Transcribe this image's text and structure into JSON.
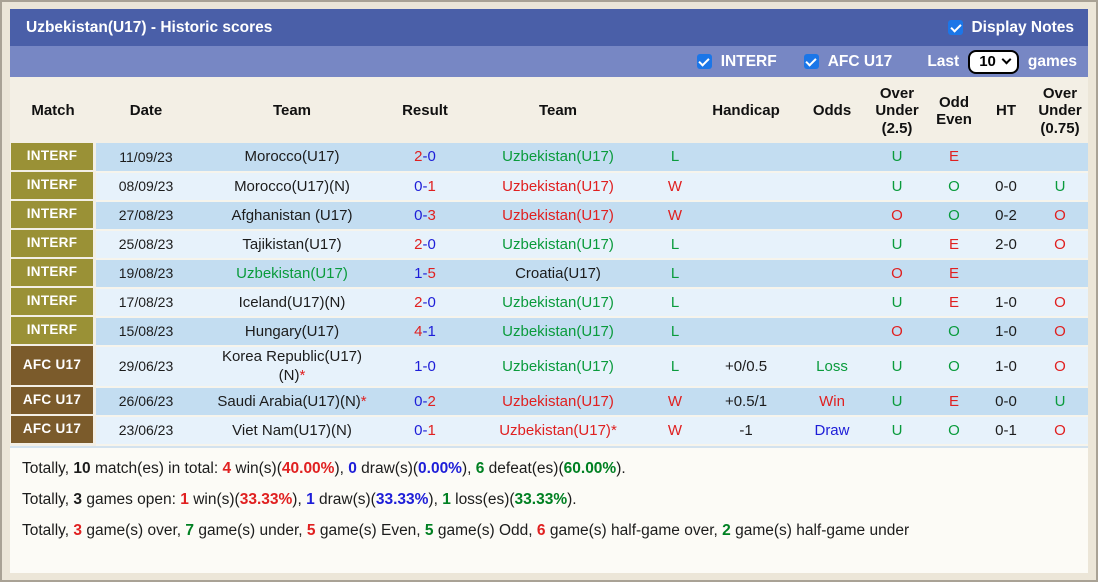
{
  "title": "Uzbekistan(U17) - Historic scores",
  "display_notes": {
    "label": "Display Notes",
    "checked": true
  },
  "filters": {
    "interf_label": "INTERF",
    "interf_checked": true,
    "afc_label": "AFC U17",
    "afc_checked": true,
    "last_label": "Last",
    "last_value": "10",
    "games_label": "games"
  },
  "colors": {
    "red": "#e02020",
    "blue": "#1d1dd8",
    "green": "#0a9b3c",
    "dark_green": "#008022",
    "black": "#1c1c1c",
    "title_bar": "#4a5fa8",
    "filter_bar": "#7787c4",
    "badge_interf": "#9a9136",
    "badge_afc": "#7b5b2b",
    "row_dark": "#c3ddf1",
    "row_light": "#e7f2fb",
    "checkbox_blue": "#1b76e8"
  },
  "table": {
    "columns": [
      {
        "key": "match",
        "label": "Match"
      },
      {
        "key": "date",
        "label": "Date"
      },
      {
        "key": "team1",
        "label": "Team"
      },
      {
        "key": "result",
        "label": "Result"
      },
      {
        "key": "team2",
        "label": "Team"
      },
      {
        "key": "wl",
        "label": ""
      },
      {
        "key": "handicap",
        "label": "Handicap"
      },
      {
        "key": "odds",
        "label": "Odds"
      },
      {
        "key": "ou25",
        "label": "Over Under (2.5)"
      },
      {
        "key": "oddeven",
        "label": "Odd Even"
      },
      {
        "key": "ht",
        "label": "HT"
      },
      {
        "key": "ou075",
        "label": "Over Under (0.75)"
      }
    ],
    "rows": [
      {
        "league": "INTERF",
        "league_key": "interf",
        "date": "11/09/23",
        "home": {
          "text": "Morocco(U17)",
          "color": "black"
        },
        "score": [
          [
            "2",
            "red"
          ],
          [
            "-0",
            "blue"
          ]
        ],
        "away": {
          "text": "Uzbekistan(U17)",
          "color": "green"
        },
        "wl": [
          "L",
          "green"
        ],
        "handicap": "",
        "odds": [
          "",
          ""
        ],
        "ou25": [
          "U",
          "green"
        ],
        "oe": [
          "E",
          "red"
        ],
        "ht": "",
        "ou075": [
          "",
          ""
        ],
        "shade": "dark"
      },
      {
        "league": "INTERF",
        "league_key": "interf",
        "date": "08/09/23",
        "home": {
          "text": "Morocco(U17)(N)",
          "color": "black"
        },
        "score": [
          [
            "0-",
            "blue"
          ],
          [
            "1",
            "red"
          ]
        ],
        "away": {
          "text": "Uzbekistan(U17)",
          "color": "red"
        },
        "wl": [
          "W",
          "red"
        ],
        "handicap": "",
        "odds": [
          "",
          ""
        ],
        "ou25": [
          "U",
          "green"
        ],
        "oe": [
          "O",
          "green"
        ],
        "ht": "0-0",
        "ou075": [
          "U",
          "green"
        ],
        "shade": "light"
      },
      {
        "league": "INTERF",
        "league_key": "interf",
        "date": "27/08/23",
        "home": {
          "text": "Afghanistan (U17)",
          "color": "black"
        },
        "score": [
          [
            "0-",
            "blue"
          ],
          [
            "3",
            "red"
          ]
        ],
        "away": {
          "text": "Uzbekistan(U17)",
          "color": "red"
        },
        "wl": [
          "W",
          "red"
        ],
        "handicap": "",
        "odds": [
          "",
          ""
        ],
        "ou25": [
          "O",
          "red"
        ],
        "oe": [
          "O",
          "green"
        ],
        "ht": "0-2",
        "ou075": [
          "O",
          "red"
        ],
        "shade": "dark"
      },
      {
        "league": "INTERF",
        "league_key": "interf",
        "date": "25/08/23",
        "home": {
          "text": "Tajikistan(U17)",
          "color": "black"
        },
        "score": [
          [
            "2",
            "red"
          ],
          [
            "-0",
            "blue"
          ]
        ],
        "away": {
          "text": "Uzbekistan(U17)",
          "color": "green"
        },
        "wl": [
          "L",
          "green"
        ],
        "handicap": "",
        "odds": [
          "",
          ""
        ],
        "ou25": [
          "U",
          "green"
        ],
        "oe": [
          "E",
          "red"
        ],
        "ht": "2-0",
        "ou075": [
          "O",
          "red"
        ],
        "shade": "light"
      },
      {
        "league": "INTERF",
        "league_key": "interf",
        "date": "19/08/23",
        "home": {
          "text": "Uzbekistan(U17)",
          "color": "green"
        },
        "score": [
          [
            "1-",
            "blue"
          ],
          [
            "5",
            "red"
          ]
        ],
        "away": {
          "text": "Croatia(U17)",
          "color": "black"
        },
        "wl": [
          "L",
          "green"
        ],
        "handicap": "",
        "odds": [
          "",
          ""
        ],
        "ou25": [
          "O",
          "red"
        ],
        "oe": [
          "E",
          "red"
        ],
        "ht": "",
        "ou075": [
          "",
          ""
        ],
        "shade": "dark"
      },
      {
        "league": "INTERF",
        "league_key": "interf",
        "date": "17/08/23",
        "home": {
          "text": "Iceland(U17)(N)",
          "color": "black"
        },
        "score": [
          [
            "2",
            "red"
          ],
          [
            "-0",
            "blue"
          ]
        ],
        "away": {
          "text": "Uzbekistan(U17)",
          "color": "green"
        },
        "wl": [
          "L",
          "green"
        ],
        "handicap": "",
        "odds": [
          "",
          ""
        ],
        "ou25": [
          "U",
          "green"
        ],
        "oe": [
          "E",
          "red"
        ],
        "ht": "1-0",
        "ou075": [
          "O",
          "red"
        ],
        "shade": "light"
      },
      {
        "league": "INTERF",
        "league_key": "interf",
        "date": "15/08/23",
        "home": {
          "text": "Hungary(U17)",
          "color": "black"
        },
        "score": [
          [
            "4",
            "red"
          ],
          [
            "-1",
            "blue"
          ]
        ],
        "away": {
          "text": "Uzbekistan(U17)",
          "color": "green"
        },
        "wl": [
          "L",
          "green"
        ],
        "handicap": "",
        "odds": [
          "",
          ""
        ],
        "ou25": [
          "O",
          "red"
        ],
        "oe": [
          "O",
          "green"
        ],
        "ht": "1-0",
        "ou075": [
          "O",
          "red"
        ],
        "shade": "dark"
      },
      {
        "league": "AFC U17",
        "league_key": "afc",
        "date": "29/06/23",
        "home": {
          "line1": "Korea Republic(U17)",
          "line2": "(N)",
          "star": true,
          "color": "black"
        },
        "score": [
          [
            "1-0",
            "blue"
          ]
        ],
        "away": {
          "text": "Uzbekistan(U17)",
          "color": "green"
        },
        "wl": [
          "L",
          "green"
        ],
        "handicap": "+0/0.5",
        "odds": [
          "Loss",
          "green"
        ],
        "ou25": [
          "U",
          "green"
        ],
        "oe": [
          "O",
          "green"
        ],
        "ht": "1-0",
        "ou075": [
          "O",
          "red"
        ],
        "shade": "light"
      },
      {
        "league": "AFC U17",
        "league_key": "afc",
        "date": "26/06/23",
        "home": {
          "text": "Saudi Arabia(U17)(N)",
          "star": true,
          "color": "black"
        },
        "score": [
          [
            "0-",
            "blue"
          ],
          [
            "2",
            "red"
          ]
        ],
        "away": {
          "text": "Uzbekistan(U17)",
          "color": "red"
        },
        "wl": [
          "W",
          "red"
        ],
        "handicap": "+0.5/1",
        "odds": [
          "Win",
          "red"
        ],
        "ou25": [
          "U",
          "green"
        ],
        "oe": [
          "E",
          "red"
        ],
        "ht": "0-0",
        "ou075": [
          "U",
          "green"
        ],
        "shade": "dark"
      },
      {
        "league": "AFC U17",
        "league_key": "afc",
        "date": "23/06/23",
        "home": {
          "text": "Viet Nam(U17)(N)",
          "color": "black"
        },
        "score": [
          [
            "0-",
            "blue"
          ],
          [
            "1",
            "red"
          ]
        ],
        "away": {
          "text": "Uzbekistan(U17)",
          "color": "red",
          "star": true
        },
        "wl": [
          "W",
          "red"
        ],
        "handicap": "-1",
        "odds": [
          "Draw",
          "blue"
        ],
        "ou25": [
          "U",
          "green"
        ],
        "oe": [
          "O",
          "green"
        ],
        "ht": "0-1",
        "ou075": [
          "O",
          "red"
        ],
        "shade": "light"
      }
    ]
  },
  "summary": [
    [
      [
        "Totally, ",
        "black",
        false
      ],
      [
        "10",
        "black",
        true
      ],
      [
        " match(es) in total: ",
        "black",
        false
      ],
      [
        "4",
        "red",
        true
      ],
      [
        " win(s)(",
        "black",
        false
      ],
      [
        "40.00%",
        "red",
        true
      ],
      [
        "), ",
        "black",
        false
      ],
      [
        "0",
        "blue",
        true
      ],
      [
        " draw(s)(",
        "black",
        false
      ],
      [
        "0.00%",
        "blue",
        true
      ],
      [
        "), ",
        "black",
        false
      ],
      [
        "6",
        "dark_green",
        true
      ],
      [
        " defeat(es)(",
        "black",
        false
      ],
      [
        "60.00%",
        "dark_green",
        true
      ],
      [
        ").",
        "black",
        false
      ]
    ],
    [
      [
        "Totally, ",
        "black",
        false
      ],
      [
        "3",
        "black",
        true
      ],
      [
        " games open: ",
        "black",
        false
      ],
      [
        "1",
        "red",
        true
      ],
      [
        " win(s)(",
        "black",
        false
      ],
      [
        "33.33%",
        "red",
        true
      ],
      [
        "), ",
        "black",
        false
      ],
      [
        "1",
        "blue",
        true
      ],
      [
        " draw(s)(",
        "black",
        false
      ],
      [
        "33.33%",
        "blue",
        true
      ],
      [
        "), ",
        "black",
        false
      ],
      [
        "1",
        "dark_green",
        true
      ],
      [
        " loss(es)(",
        "black",
        false
      ],
      [
        "33.33%",
        "dark_green",
        true
      ],
      [
        ").",
        "black",
        false
      ]
    ],
    [
      [
        "Totally, ",
        "black",
        false
      ],
      [
        "3",
        "red",
        true
      ],
      [
        " game(s) over, ",
        "black",
        false
      ],
      [
        "7",
        "dark_green",
        true
      ],
      [
        " game(s) under, ",
        "black",
        false
      ],
      [
        "5",
        "red",
        true
      ],
      [
        " game(s) Even, ",
        "black",
        false
      ],
      [
        "5",
        "dark_green",
        true
      ],
      [
        " game(s) Odd, ",
        "black",
        false
      ],
      [
        "6",
        "red",
        true
      ],
      [
        " game(s) half-game over, ",
        "black",
        false
      ],
      [
        "2",
        "dark_green",
        true
      ],
      [
        " game(s) half-game under",
        "black",
        false
      ]
    ]
  ]
}
